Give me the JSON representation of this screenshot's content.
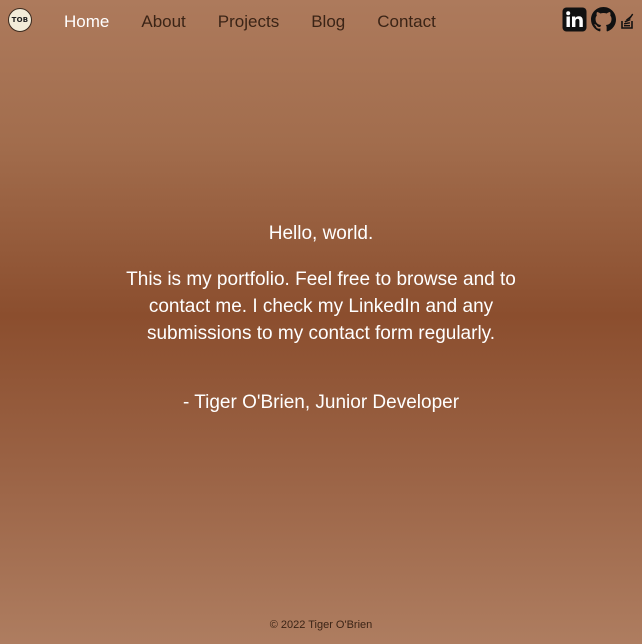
{
  "logo": {
    "text": "TOB"
  },
  "nav": {
    "items": [
      {
        "label": "Home",
        "active": true
      },
      {
        "label": "About",
        "active": false
      },
      {
        "label": "Projects",
        "active": false
      },
      {
        "label": "Blog",
        "active": false
      },
      {
        "label": "Contact",
        "active": false
      }
    ]
  },
  "social": {
    "icons": [
      "linkedin-icon",
      "github-icon",
      "stack-overflow-icon"
    ]
  },
  "hero": {
    "greeting": "Hello, world.",
    "intro": "This is my portfolio. Feel free to browse and to contact me. I check my LinkedIn and any submissions to my contact form regularly.",
    "signature": "- Tiger O'Brien, Junior Developer"
  },
  "footer": {
    "copyright": "© 2022 Tiger O'Brien"
  },
  "colors": {
    "nav_text": "#3b2416",
    "active_text": "#ffffff",
    "bg_top": "#ad7a5c",
    "bg_mid": "#8b4e2e",
    "bg_bottom": "#ae7d60"
  }
}
